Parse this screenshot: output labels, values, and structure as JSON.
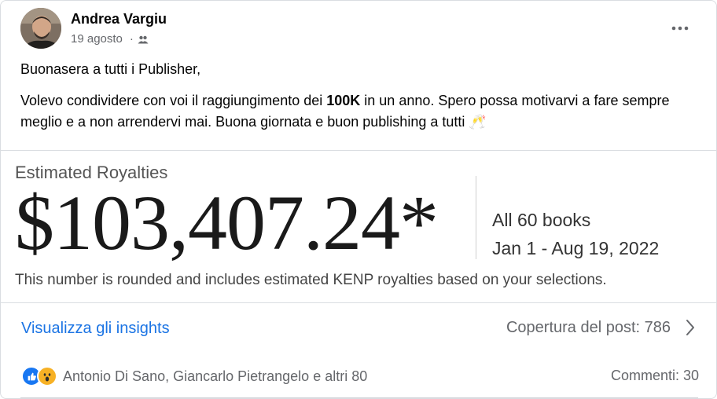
{
  "post": {
    "author": "Andrea Vargiu",
    "date": "19 agosto",
    "dot": "·",
    "audience_icon": "friends-icon",
    "greeting": "Buonasera a tutti i Publisher,",
    "body_before": "Volevo condividere con voi il raggiungimento dei ",
    "body_bold": "100K",
    "body_after": " in un anno. Spero possa motivarvi a fare sempre meglio e a non arrendervi mai. Buona giornata e buon publishing a tutti ",
    "body_emoji": "🥂"
  },
  "media": {
    "label": "Estimated Royalties",
    "amount": "$103,407.24*",
    "books": "All 60 books",
    "dates": "Jan 1 - Aug 19, 2022",
    "note": "This number is rounded and includes estimated KENP royalties based on your selections."
  },
  "insights": {
    "link": "Visualizza gli insights",
    "reach": "Copertura del post: 786"
  },
  "footer": {
    "reactors": "Antonio Di Sano, Giancarlo Pietrangelo e altri 80",
    "comments": "Commenti: 30",
    "reaction_icons": [
      "like-icon",
      "wow-icon"
    ]
  },
  "colors": {
    "link": "#1b74e4",
    "like": "#1877f2",
    "wow": "#f7b125",
    "secondary_text": "#65676b"
  }
}
